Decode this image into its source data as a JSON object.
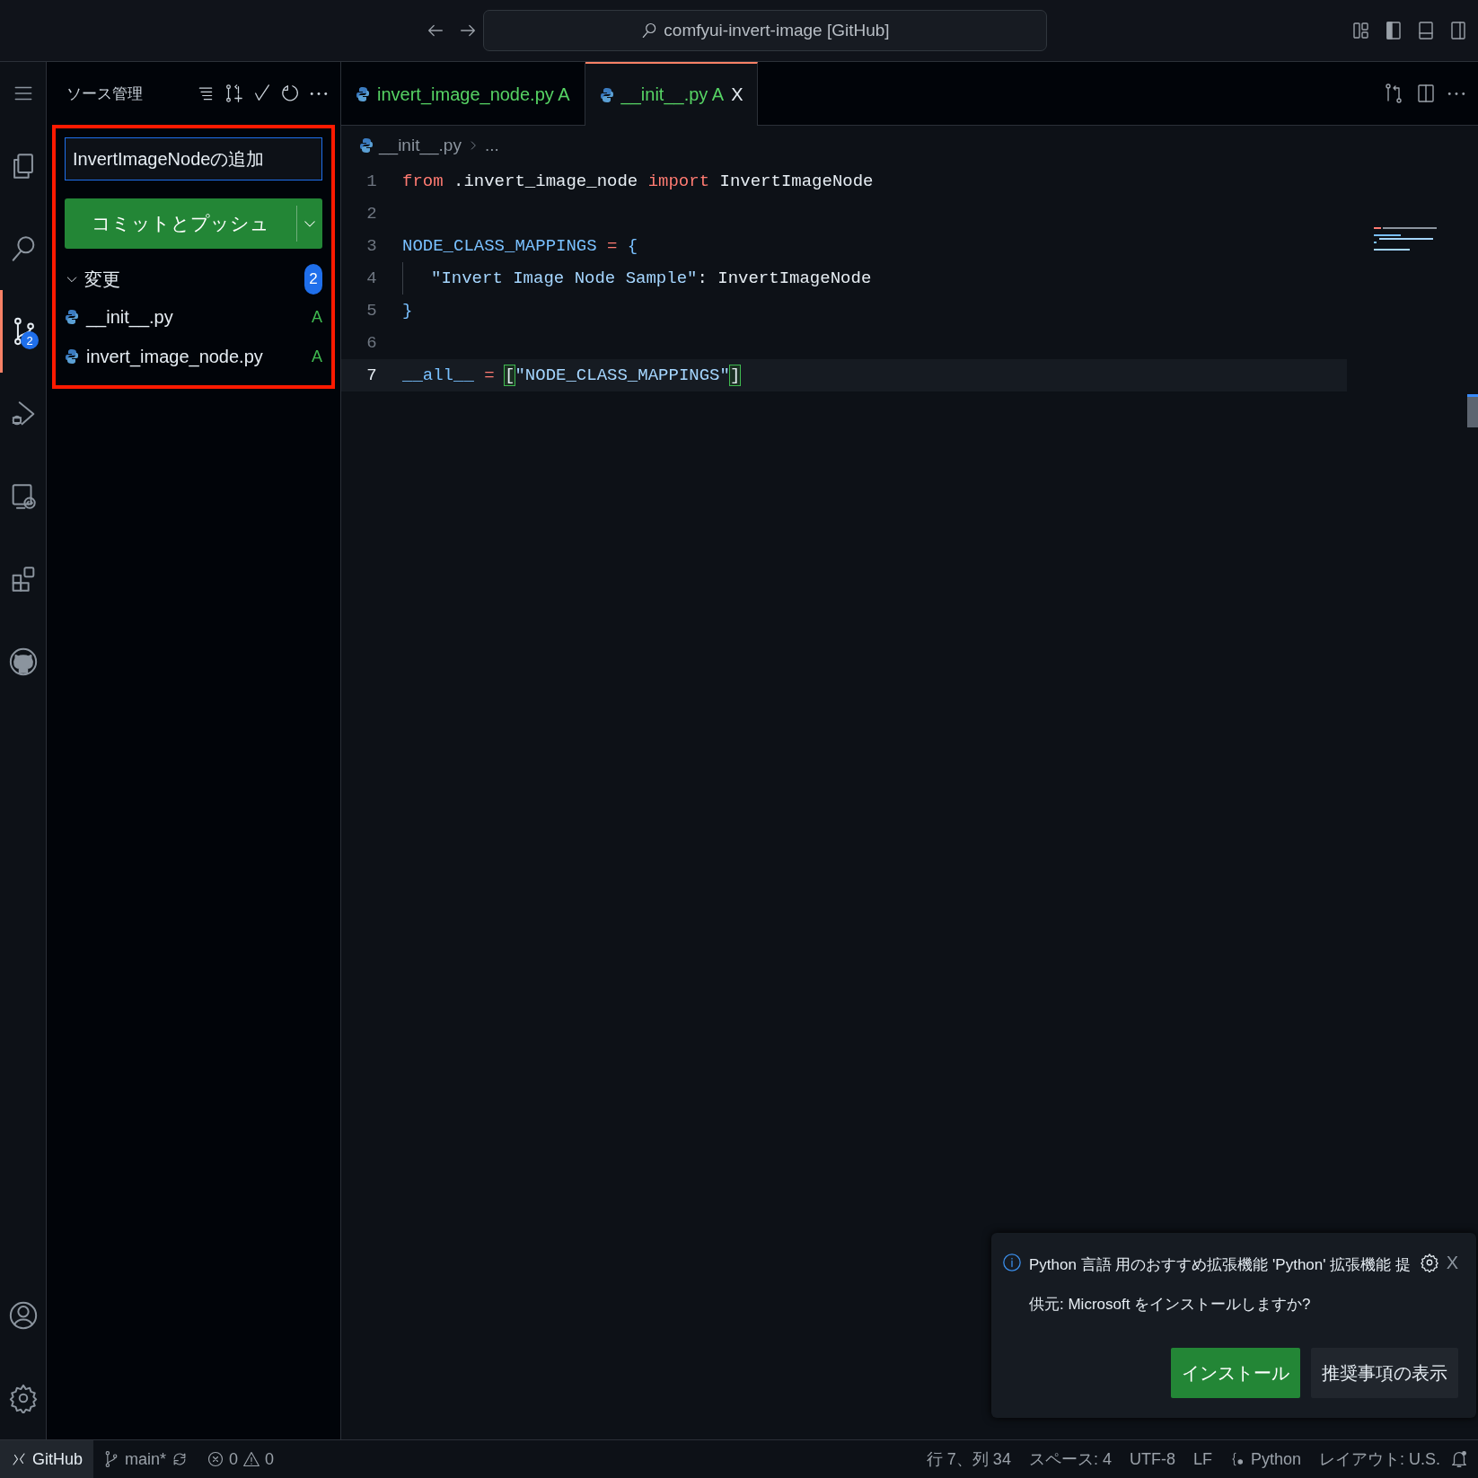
{
  "title_bar": {
    "search": "comfyui-invert-image [GitHub]"
  },
  "activity_bar": {
    "items": [
      {
        "kind": "explorer",
        "selected": false
      },
      {
        "kind": "search",
        "selected": false
      },
      {
        "kind": "scm",
        "selected": true,
        "badge": "2"
      },
      {
        "kind": "debug",
        "selected": false
      },
      {
        "kind": "remote",
        "selected": false
      },
      {
        "kind": "extensions",
        "selected": false
      },
      {
        "kind": "github",
        "selected": false
      }
    ],
    "bottom": [
      {
        "kind": "account"
      },
      {
        "kind": "settings"
      }
    ]
  },
  "sidebar": {
    "title": "ソース管理",
    "commit_message": "InvertImageNodeの追加",
    "commit_button": "コミットとプッシュ",
    "changes": {
      "label": "変更",
      "count": "2",
      "expanded": true,
      "files": [
        {
          "name": "__init__.py",
          "status": "A"
        },
        {
          "name": "invert_image_node.py",
          "status": "A"
        }
      ]
    }
  },
  "tabs": [
    {
      "label": "invert_image_node.py",
      "status": "A",
      "selected": false
    },
    {
      "label": "__init__.py",
      "status": "A",
      "close": "X",
      "selected": true
    }
  ],
  "breadcrumb": {
    "file": "__init__.py",
    "rest": "..."
  },
  "code": [
    {
      "number": "1",
      "current": false,
      "tokens": [
        {
          "kind": "keyword",
          "text": "from"
        },
        {
          "kind": "plain",
          "text": " .invert_image_node "
        },
        {
          "kind": "keyword",
          "text": "import"
        },
        {
          "kind": "plain",
          "text": " InvertImageNode"
        }
      ]
    },
    {
      "number": "2",
      "current": false
    },
    {
      "number": "3",
      "current": false,
      "tokens": [
        {
          "kind": "constant",
          "text": "NODE_CLASS_MAPPINGS"
        },
        {
          "kind": "operator",
          "text": " = "
        },
        {
          "kind": "brace",
          "text": "{"
        }
      ]
    },
    {
      "number": "4",
      "current": false,
      "indented": true,
      "tokens": [
        {
          "kind": "string",
          "text": "\"Invert Image Node Sample\""
        },
        {
          "kind": "plain",
          "text": ": InvertImageNode"
        }
      ]
    },
    {
      "number": "5",
      "current": false,
      "tokens": [
        {
          "kind": "brace",
          "text": "}"
        }
      ]
    },
    {
      "number": "6",
      "current": false
    },
    {
      "number": "7",
      "current": true,
      "tokens": [
        {
          "kind": "constant",
          "text": "__all__"
        },
        {
          "kind": "operator",
          "text": " = "
        },
        {
          "kind": "match",
          "text": "["
        },
        {
          "kind": "string",
          "text": "\"NODE_CLASS_MAPPINGS\""
        },
        {
          "kind": "match",
          "text": "]"
        }
      ]
    }
  ],
  "notification": {
    "message": "Python 言語 用のおすすめ拡張機能 'Python' 拡張機能 提供元: Microsoft をインストールしますか?",
    "close": "X",
    "buttons": [
      {
        "label": "インストール",
        "kind": "primary"
      },
      {
        "label": "推奨事項の表示",
        "kind": "secondary"
      }
    ]
  },
  "status_bar": {
    "remote": "GitHub",
    "branch": "main*",
    "errors": "0",
    "warnings": "0",
    "right": [
      {
        "kind": "text",
        "text": "行 7、列 34"
      },
      {
        "kind": "text",
        "text": "スペース: 4"
      },
      {
        "kind": "text",
        "text": "UTF-8"
      },
      {
        "kind": "text",
        "text": "LF"
      },
      {
        "kind": "language",
        "text": "Python"
      },
      {
        "kind": "text",
        "text": "レイアウト: U.S."
      }
    ]
  }
}
